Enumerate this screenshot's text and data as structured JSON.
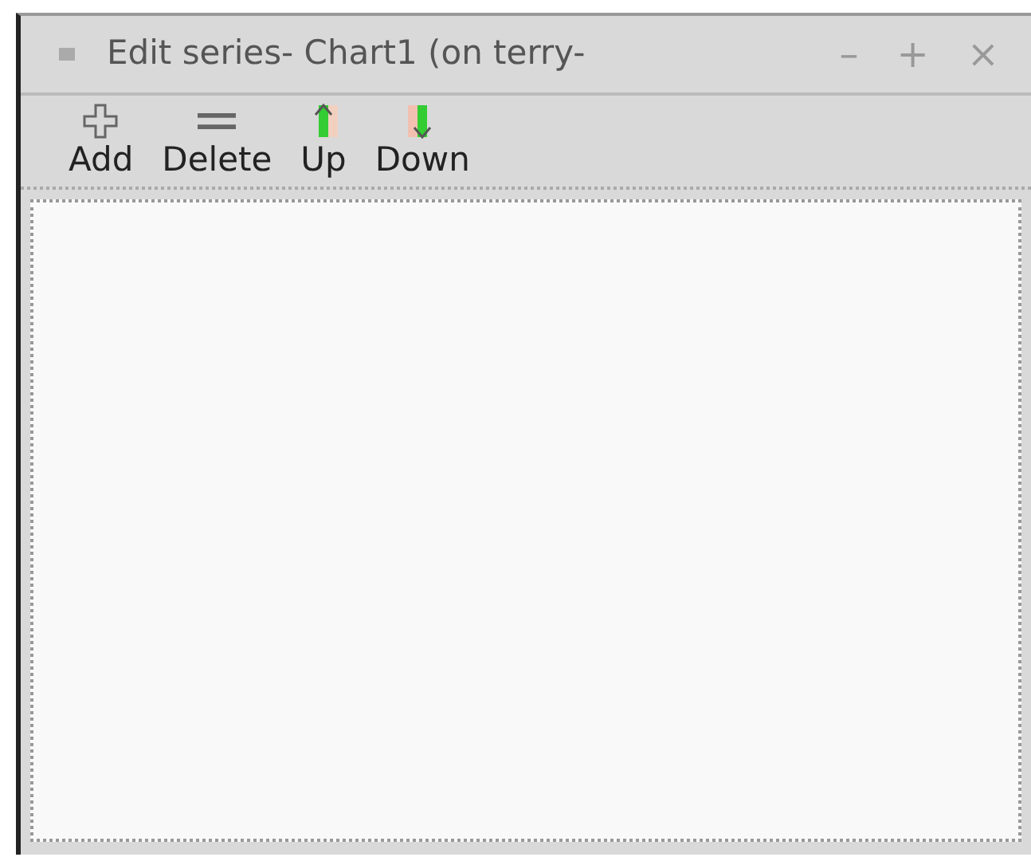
{
  "window": {
    "title": "Edit series- Chart1 (on terry-",
    "controls": [
      "–",
      "+",
      "×"
    ]
  },
  "toolbar": [
    {
      "kind": "add",
      "label": "Add"
    },
    {
      "kind": "delete",
      "label": "Delete"
    },
    {
      "kind": "up",
      "label": "Up"
    },
    {
      "kind": "down",
      "label": "Down"
    }
  ]
}
